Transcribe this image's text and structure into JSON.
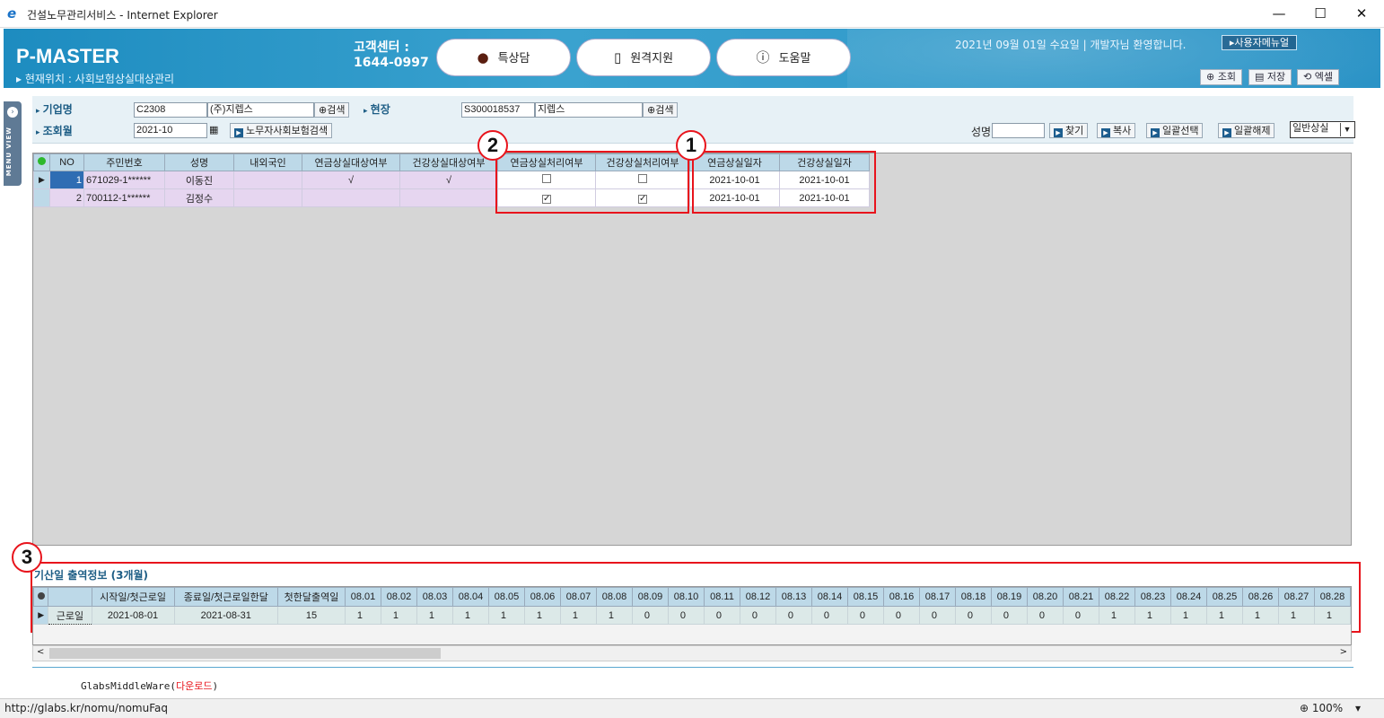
{
  "window": {
    "title": "건설노무관리서비스 - Internet Explorer",
    "minimize": "—",
    "maximize": "☐",
    "close": "✕"
  },
  "header": {
    "logo": "P-MASTER",
    "breadcrumb": "▸ 현재위치 :  사회보험상실대상관리",
    "cs_line1": "고객센터 :",
    "cs_line2": "1644-0997",
    "pill_chat": "특상담",
    "pill_remote": "원격지원",
    "pill_help": "도움말",
    "welcome": "2021년 09월 01일 수요일  |  개발자님 환영합니다.",
    "manual": "▸사용자메뉴얼",
    "btn_view": "조회",
    "btn_save": "저장",
    "btn_excel": "엑셀"
  },
  "side_tab": {
    "label": "MENU VIEW"
  },
  "search": {
    "company_label": "기업명",
    "company_code": "C2308",
    "company_name": "(주)지렙스",
    "search_btn": "검색",
    "site_label": "현장",
    "site_code": "S300018537",
    "site_name": "지렙스",
    "month_label": "조회월",
    "month_value": "2021-10",
    "insurance_btn": "노무자사회보험검색",
    "name_label": "성명",
    "name_value": "",
    "find_btn": "찾기",
    "copy_btn": "복사",
    "select_all_btn": "일괄선택",
    "deselect_all_btn": "일괄해제",
    "mode_select": "일반상실"
  },
  "main_table": {
    "columns": [
      "NO",
      "주민번호",
      "성명",
      "내외국인",
      "연금상실대상여부",
      "건강상실대상여부",
      "연금상실처리여부",
      "건강상실처리여부",
      "연금상실일자",
      "건강상실일자"
    ],
    "rows": [
      {
        "no": "1",
        "rrn": "671029-1******",
        "name": "이동진",
        "foreign": "",
        "pension_target": "√",
        "health_target": "√",
        "pension_done": false,
        "health_done": false,
        "pension_date": "2021-10-01",
        "health_date": "2021-10-01"
      },
      {
        "no": "2",
        "rrn": "700112-1******",
        "name": "김정수",
        "foreign": "",
        "pension_target": "",
        "health_target": "",
        "pension_done": true,
        "health_done": true,
        "pension_date": "2021-10-01",
        "health_date": "2021-10-01"
      }
    ]
  },
  "annotations": {
    "c1": "1",
    "c2": "2",
    "c3": "3"
  },
  "attendance": {
    "title": "기산일 출역정보 (3개월)",
    "fixed_columns": [
      "시작일/첫근로일",
      "종료일/첫근로일한달",
      "첫한달출역일"
    ],
    "day_columns": [
      "08.01",
      "08.02",
      "08.03",
      "08.04",
      "08.05",
      "08.06",
      "08.07",
      "08.08",
      "08.09",
      "08.10",
      "08.11",
      "08.12",
      "08.13",
      "08.14",
      "08.15",
      "08.16",
      "08.17",
      "08.18",
      "08.19",
      "08.20",
      "08.21",
      "08.22",
      "08.23",
      "08.24",
      "08.25",
      "08.26",
      "08.27",
      "08.28"
    ],
    "row_label": "근로일",
    "start": "2021-08-01",
    "end": "2021-08-31",
    "first_month_days": "15",
    "day_values": [
      "1",
      "1",
      "1",
      "1",
      "1",
      "1",
      "1",
      "1",
      "0",
      "0",
      "0",
      "0",
      "0",
      "0",
      "0",
      "0",
      "0",
      "0",
      "0",
      "0",
      "0",
      "1",
      "1",
      "1",
      "1",
      "1",
      "1",
      "1"
    ]
  },
  "scroll": {
    "left": "<",
    "right": ">"
  },
  "footer": {
    "middleware": "GlabsMiddleWare(",
    "download": "다운로드",
    "close_paren": ")"
  },
  "status": {
    "url": "http://glabs.kr/nomu/nomuFaq",
    "zoom": "100%"
  }
}
